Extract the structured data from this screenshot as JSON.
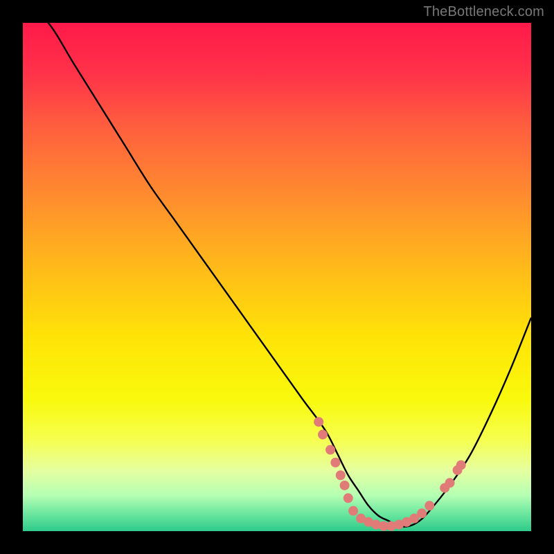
{
  "attribution": "TheBottleneck.com",
  "chart_data": {
    "type": "line",
    "title": "",
    "xlabel": "",
    "ylabel": "",
    "xlim": [
      0,
      100
    ],
    "ylim": [
      0,
      100
    ],
    "grid": false,
    "gradient_stops": [
      {
        "offset": 0.0,
        "color": "#ff1a49"
      },
      {
        "offset": 0.1,
        "color": "#ff3249"
      },
      {
        "offset": 0.2,
        "color": "#ff5d3f"
      },
      {
        "offset": 0.35,
        "color": "#ff8f2d"
      },
      {
        "offset": 0.5,
        "color": "#ffc017"
      },
      {
        "offset": 0.62,
        "color": "#ffe407"
      },
      {
        "offset": 0.74,
        "color": "#f9f90c"
      },
      {
        "offset": 0.82,
        "color": "#f6ff4f"
      },
      {
        "offset": 0.88,
        "color": "#e6ffa0"
      },
      {
        "offset": 0.93,
        "color": "#b4ffb3"
      },
      {
        "offset": 0.97,
        "color": "#63e39c"
      },
      {
        "offset": 1.0,
        "color": "#2fca8a"
      }
    ],
    "series": [
      {
        "name": "bottleneck-curve",
        "x": [
          0,
          5,
          10,
          15,
          20,
          25,
          30,
          35,
          40,
          45,
          50,
          55,
          58,
          60,
          62,
          64,
          66,
          68,
          70,
          72,
          74,
          76,
          78,
          80,
          84,
          88,
          92,
          96,
          100
        ],
        "y": [
          104,
          100,
          92,
          84,
          76,
          68,
          61,
          54,
          47,
          40,
          33,
          26,
          22,
          19,
          15,
          11,
          8,
          5,
          3,
          2,
          1,
          1,
          2,
          4,
          9,
          15,
          23,
          32,
          42
        ]
      }
    ],
    "markers": [
      {
        "x": 58.2,
        "y": 21.5
      },
      {
        "x": 59.0,
        "y": 19.0
      },
      {
        "x": 60.5,
        "y": 16.0
      },
      {
        "x": 61.5,
        "y": 13.5
      },
      {
        "x": 62.5,
        "y": 11.0
      },
      {
        "x": 63.3,
        "y": 9.0
      },
      {
        "x": 64.0,
        "y": 6.5
      },
      {
        "x": 65.0,
        "y": 4.0
      },
      {
        "x": 66.5,
        "y": 2.5
      },
      {
        "x": 68.0,
        "y": 1.8
      },
      {
        "x": 69.5,
        "y": 1.3
      },
      {
        "x": 71.0,
        "y": 1.0
      },
      {
        "x": 72.5,
        "y": 1.0
      },
      {
        "x": 74.0,
        "y": 1.3
      },
      {
        "x": 75.5,
        "y": 1.8
      },
      {
        "x": 77.0,
        "y": 2.5
      },
      {
        "x": 78.5,
        "y": 3.5
      },
      {
        "x": 80.0,
        "y": 5.0
      },
      {
        "x": 83.0,
        "y": 8.5
      },
      {
        "x": 84.0,
        "y": 9.5
      },
      {
        "x": 85.5,
        "y": 12.0
      },
      {
        "x": 86.2,
        "y": 13.0
      }
    ],
    "marker_color": "#e07b78",
    "marker_radius": 7
  }
}
